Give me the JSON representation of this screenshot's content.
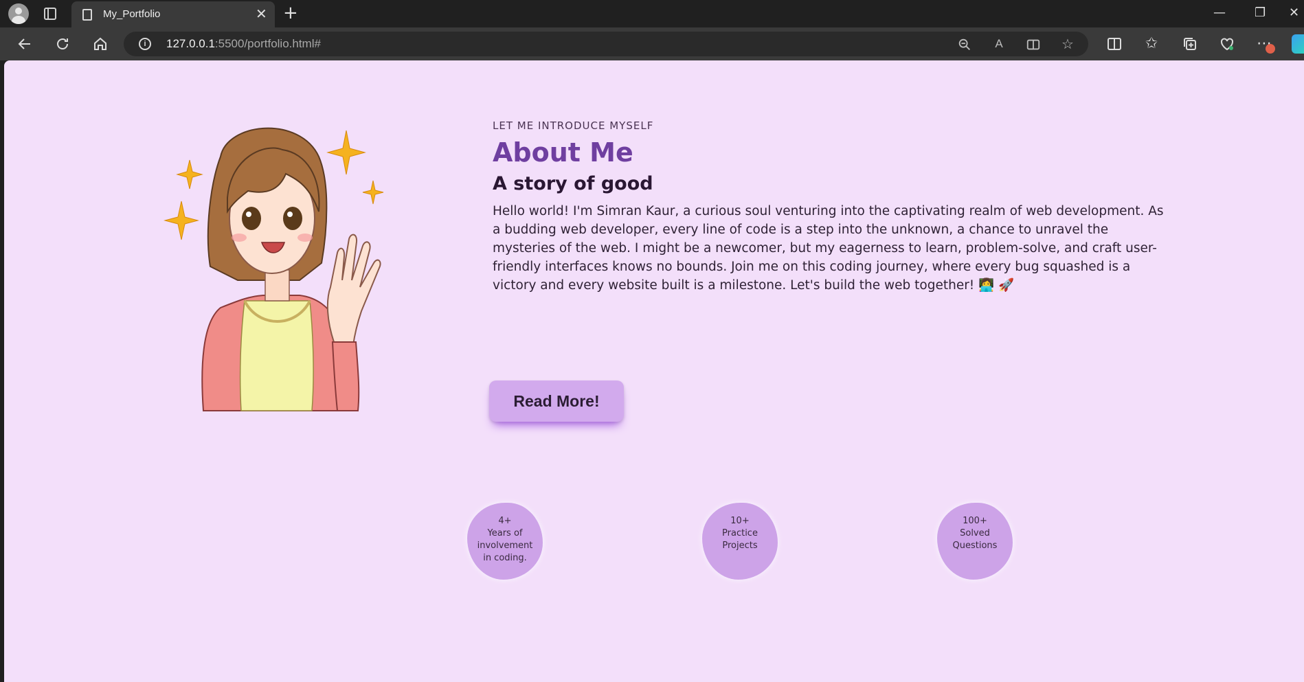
{
  "browser": {
    "tab_title": "My_Portfolio",
    "tab_close": "✕",
    "new_tab": "+",
    "url_host": "127.0.0.1",
    "url_rest": ":5500/portfolio.html#",
    "window_controls": {
      "minimize": "—",
      "restore": "❐",
      "close": "✕"
    },
    "toolbar_icons": [
      "back-icon",
      "refresh-icon",
      "home-icon"
    ],
    "address_icons": [
      "zoom-icon",
      "read-aloud-icon",
      "immersive-reader-icon",
      "favorite-star-icon"
    ],
    "right_icons": [
      "split-screen-icon",
      "favorites-icon",
      "collections-icon",
      "browser-essentials-icon",
      "more-icon"
    ]
  },
  "about": {
    "intro": "LET ME INTRODUCE MYSELF",
    "heading": "About Me",
    "subheading": "A story of good",
    "paragraph": "Hello world! I'm Simran Kaur, a curious soul venturing into the captivating realm of web development. As a budding web developer, every line of code is a step into the unknown, a chance to unravel the mysteries of the web. I might be a newcomer, but my eagerness to learn, problem-solve, and craft user-friendly interfaces knows no bounds. Join me on this coding journey, where every bug squashed is a victory and every website built is a milestone. Let's build the web together! 👩‍💻 🚀",
    "button": "Read More!"
  },
  "stats": [
    {
      "number": "4+",
      "label": "Years of involvement in coding."
    },
    {
      "number": "10+",
      "label": "Practice Projects"
    },
    {
      "number": "100+",
      "label": "Solved Questions"
    }
  ],
  "colors": {
    "page_bg": "#f3dffa",
    "heading": "#6f3fa0",
    "button_bg": "#d2aaed",
    "stat_bg": "#cda3e8"
  }
}
